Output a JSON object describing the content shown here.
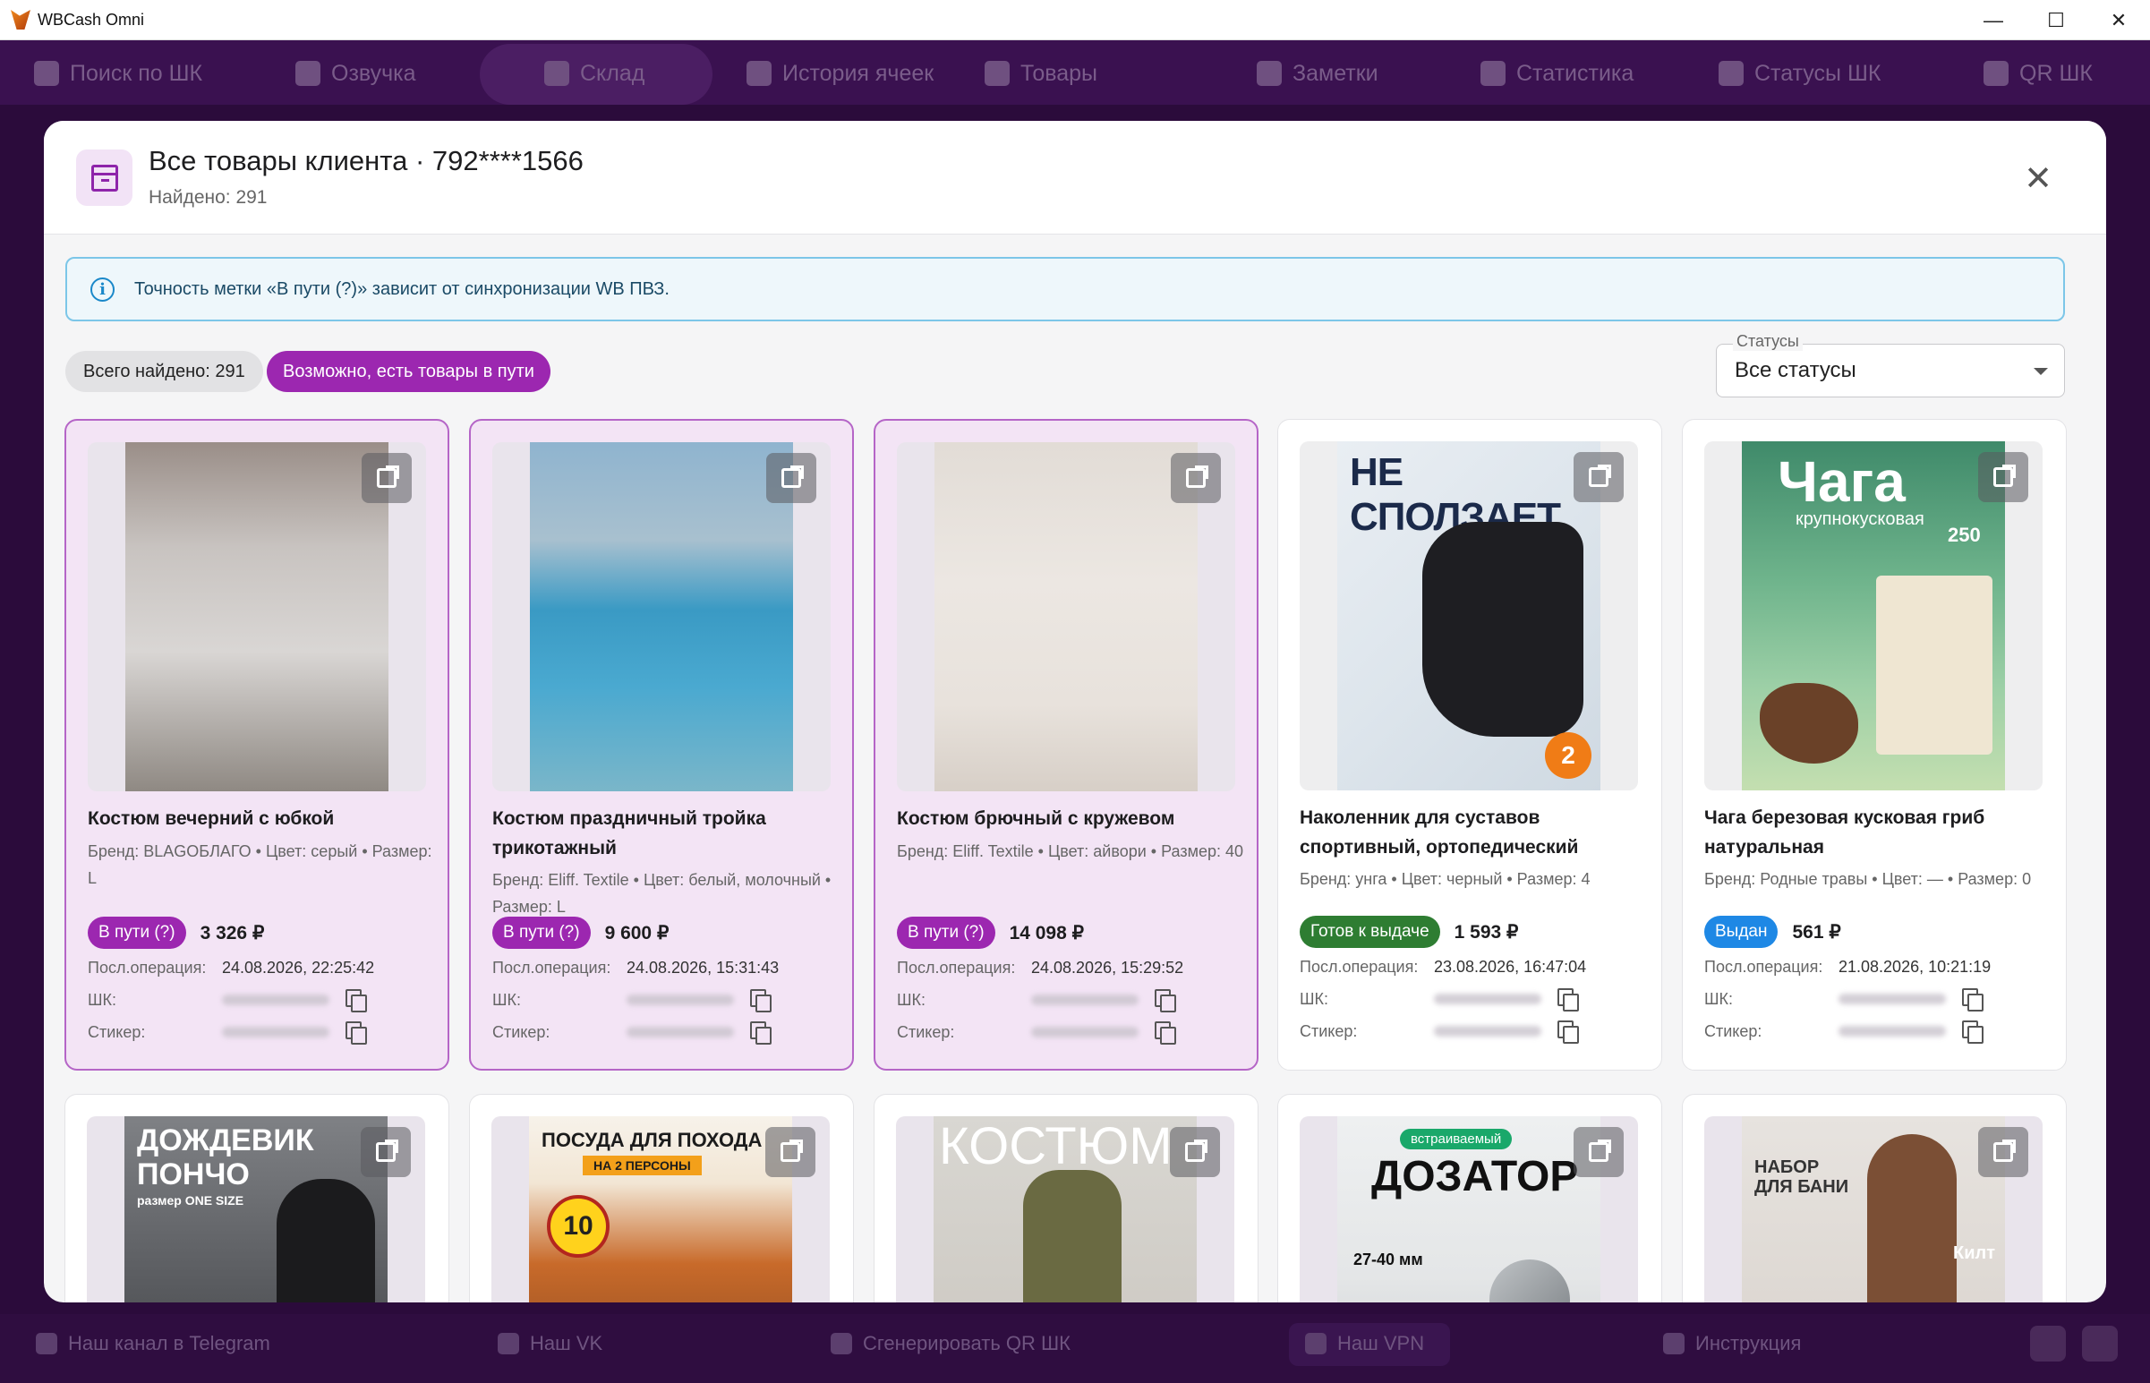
{
  "window": {
    "title": "WBCash Omni",
    "minimize": "—",
    "maximize": "☐",
    "close": "✕"
  },
  "nav": {
    "items": [
      {
        "label": "Поиск по ШК",
        "icon": "archive-icon"
      },
      {
        "label": "Озвучка",
        "icon": "voice-icon"
      },
      {
        "label": "Склад",
        "icon": "warehouse-icon"
      },
      {
        "label": "История ячеек",
        "icon": "history-icon"
      },
      {
        "label": "Товары",
        "icon": "search-icon"
      },
      {
        "label": "Заметки",
        "icon": "notes-icon"
      },
      {
        "label": "Статистика",
        "icon": "chart-icon"
      },
      {
        "label": "Статусы ШК",
        "icon": "list-icon"
      },
      {
        "label": "QR ШК",
        "icon": "qr-icon"
      }
    ]
  },
  "bottom": {
    "telegram": "Наш канал в Telegram",
    "vk": "Наш VK",
    "qr": "Сгенерировать QR ШК",
    "vpn": "Наш VPN",
    "manual": "Инструкция"
  },
  "modal": {
    "title": "Все товары клиента · 792****1566",
    "subtitle": "Найдено: 291",
    "close": "✕",
    "info": "Точность метки «В пути (?)» зависит от синхронизации WB ПВЗ.",
    "chip_total": "Всего найдено: 291",
    "chip_transit": "Возможно, есть товары в пути",
    "filter_label": "Статусы",
    "filter_value": "Все статусы"
  },
  "labels": {
    "last_op": "Посл.операция:",
    "barcode": "ШК:",
    "sticker": "Стикер:"
  },
  "cards": [
    {
      "title": "Костюм вечерний с юбкой",
      "meta": "Бренд: BLAGOБЛАГО • Цвет: серый • Размер: L",
      "status": "В пути (?)",
      "price": "3 326 ₽",
      "last_op": "24.08.2026, 22:25:42"
    },
    {
      "title": "Костюм праздничный тройка трикотажный",
      "meta": "Бренд: Eliff. Textile • Цвет: белый, молочный • Размер: L",
      "status": "В пути (?)",
      "price": "9 600 ₽",
      "last_op": "24.08.2026, 15:31:43"
    },
    {
      "title": "Костюм брючный с кружевом",
      "meta": "Бренд: Eliff. Textile • Цвет: айвори • Размер: 40",
      "status": "В пути (?)",
      "price": "14 098 ₽",
      "last_op": "24.08.2026, 15:29:52"
    },
    {
      "title": "Наколенник для суставов спортивный, ортопедический",
      "meta": "Бренд: унга • Цвет: черный • Размер: 4",
      "status": "Готов к выдаче",
      "price": "1 593 ₽",
      "last_op": "23.08.2026, 16:47:04"
    },
    {
      "title": "Чага березовая кусковая гриб натуральная",
      "meta": "Бренд: Родные травы • Цвет: — • Размер: 0",
      "status": "Выдан",
      "price": "561 ₽",
      "last_op": "21.08.2026, 10:21:19"
    }
  ],
  "row2_photo_text": {
    "c1a": "ДОЖДЕВИК",
    "c1b": "ПОНЧО",
    "c1c": "размер ONE SIZE",
    "c2a": "ПОСУДА ДЛЯ ПОХОДА",
    "c2b": "НА 2 ПЕРСОНЫ",
    "c2c": "10",
    "c3a": "КОСТЮМ",
    "c4a": "встраиваемый",
    "c4b": "ДОЗАТОР",
    "c4c": "27-40 мм",
    "c5a": "НАБОР ДЛЯ БАНИ",
    "c5b": "Килт"
  },
  "photo_text": {
    "knee_a": "НЕ СПОЛЗАЕТ",
    "knee_b": "2",
    "chaga_a": "Чага",
    "chaga_b": "крупнокусковая",
    "chaga_c": "250"
  },
  "colors": {
    "accent": "#9c27b0",
    "ready": "#2e7d32",
    "issued": "#1e88e5",
    "info_border": "#7cc6e8"
  }
}
